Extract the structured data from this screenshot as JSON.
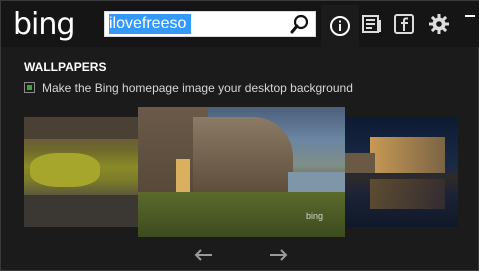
{
  "header": {
    "logo_text": "bing",
    "search_value": "ilovefreeso"
  },
  "toolbar": {
    "info_icon": "info-circle-icon",
    "news_icon": "news-icon",
    "facebook_icon": "facebook-icon",
    "settings_icon": "gear-icon"
  },
  "wallpapers": {
    "title": "WALLPAPERS",
    "checkbox_label": "Make the Bing homepage image your desktop background",
    "checked": true,
    "accent": "#3fa43a"
  },
  "thumbnails": [
    {
      "name": "yellow-lagoon"
    },
    {
      "name": "cliff-ruins",
      "watermark": "bing"
    },
    {
      "name": "city-building-night"
    }
  ],
  "nav": {
    "prev_icon": "arrow-left-icon",
    "next_icon": "arrow-right-icon"
  }
}
